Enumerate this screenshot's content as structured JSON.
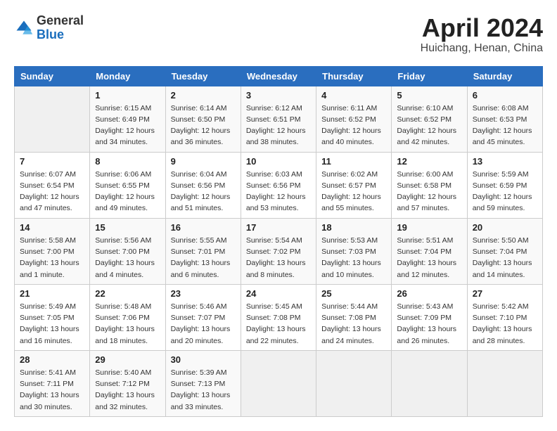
{
  "header": {
    "logo_general": "General",
    "logo_blue": "Blue",
    "title": "April 2024",
    "location": "Huichang, Henan, China"
  },
  "days_of_week": [
    "Sunday",
    "Monday",
    "Tuesday",
    "Wednesday",
    "Thursday",
    "Friday",
    "Saturday"
  ],
  "weeks": [
    [
      {
        "day": "",
        "info": ""
      },
      {
        "day": "1",
        "info": "Sunrise: 6:15 AM\nSunset: 6:49 PM\nDaylight: 12 hours\nand 34 minutes."
      },
      {
        "day": "2",
        "info": "Sunrise: 6:14 AM\nSunset: 6:50 PM\nDaylight: 12 hours\nand 36 minutes."
      },
      {
        "day": "3",
        "info": "Sunrise: 6:12 AM\nSunset: 6:51 PM\nDaylight: 12 hours\nand 38 minutes."
      },
      {
        "day": "4",
        "info": "Sunrise: 6:11 AM\nSunset: 6:52 PM\nDaylight: 12 hours\nand 40 minutes."
      },
      {
        "day": "5",
        "info": "Sunrise: 6:10 AM\nSunset: 6:52 PM\nDaylight: 12 hours\nand 42 minutes."
      },
      {
        "day": "6",
        "info": "Sunrise: 6:08 AM\nSunset: 6:53 PM\nDaylight: 12 hours\nand 45 minutes."
      }
    ],
    [
      {
        "day": "7",
        "info": "Sunrise: 6:07 AM\nSunset: 6:54 PM\nDaylight: 12 hours\nand 47 minutes."
      },
      {
        "day": "8",
        "info": "Sunrise: 6:06 AM\nSunset: 6:55 PM\nDaylight: 12 hours\nand 49 minutes."
      },
      {
        "day": "9",
        "info": "Sunrise: 6:04 AM\nSunset: 6:56 PM\nDaylight: 12 hours\nand 51 minutes."
      },
      {
        "day": "10",
        "info": "Sunrise: 6:03 AM\nSunset: 6:56 PM\nDaylight: 12 hours\nand 53 minutes."
      },
      {
        "day": "11",
        "info": "Sunrise: 6:02 AM\nSunset: 6:57 PM\nDaylight: 12 hours\nand 55 minutes."
      },
      {
        "day": "12",
        "info": "Sunrise: 6:00 AM\nSunset: 6:58 PM\nDaylight: 12 hours\nand 57 minutes."
      },
      {
        "day": "13",
        "info": "Sunrise: 5:59 AM\nSunset: 6:59 PM\nDaylight: 12 hours\nand 59 minutes."
      }
    ],
    [
      {
        "day": "14",
        "info": "Sunrise: 5:58 AM\nSunset: 7:00 PM\nDaylight: 13 hours\nand 1 minute."
      },
      {
        "day": "15",
        "info": "Sunrise: 5:56 AM\nSunset: 7:00 PM\nDaylight: 13 hours\nand 4 minutes."
      },
      {
        "day": "16",
        "info": "Sunrise: 5:55 AM\nSunset: 7:01 PM\nDaylight: 13 hours\nand 6 minutes."
      },
      {
        "day": "17",
        "info": "Sunrise: 5:54 AM\nSunset: 7:02 PM\nDaylight: 13 hours\nand 8 minutes."
      },
      {
        "day": "18",
        "info": "Sunrise: 5:53 AM\nSunset: 7:03 PM\nDaylight: 13 hours\nand 10 minutes."
      },
      {
        "day": "19",
        "info": "Sunrise: 5:51 AM\nSunset: 7:04 PM\nDaylight: 13 hours\nand 12 minutes."
      },
      {
        "day": "20",
        "info": "Sunrise: 5:50 AM\nSunset: 7:04 PM\nDaylight: 13 hours\nand 14 minutes."
      }
    ],
    [
      {
        "day": "21",
        "info": "Sunrise: 5:49 AM\nSunset: 7:05 PM\nDaylight: 13 hours\nand 16 minutes."
      },
      {
        "day": "22",
        "info": "Sunrise: 5:48 AM\nSunset: 7:06 PM\nDaylight: 13 hours\nand 18 minutes."
      },
      {
        "day": "23",
        "info": "Sunrise: 5:46 AM\nSunset: 7:07 PM\nDaylight: 13 hours\nand 20 minutes."
      },
      {
        "day": "24",
        "info": "Sunrise: 5:45 AM\nSunset: 7:08 PM\nDaylight: 13 hours\nand 22 minutes."
      },
      {
        "day": "25",
        "info": "Sunrise: 5:44 AM\nSunset: 7:08 PM\nDaylight: 13 hours\nand 24 minutes."
      },
      {
        "day": "26",
        "info": "Sunrise: 5:43 AM\nSunset: 7:09 PM\nDaylight: 13 hours\nand 26 minutes."
      },
      {
        "day": "27",
        "info": "Sunrise: 5:42 AM\nSunset: 7:10 PM\nDaylight: 13 hours\nand 28 minutes."
      }
    ],
    [
      {
        "day": "28",
        "info": "Sunrise: 5:41 AM\nSunset: 7:11 PM\nDaylight: 13 hours\nand 30 minutes."
      },
      {
        "day": "29",
        "info": "Sunrise: 5:40 AM\nSunset: 7:12 PM\nDaylight: 13 hours\nand 32 minutes."
      },
      {
        "day": "30",
        "info": "Sunrise: 5:39 AM\nSunset: 7:13 PM\nDaylight: 13 hours\nand 33 minutes."
      },
      {
        "day": "",
        "info": ""
      },
      {
        "day": "",
        "info": ""
      },
      {
        "day": "",
        "info": ""
      },
      {
        "day": "",
        "info": ""
      }
    ]
  ]
}
